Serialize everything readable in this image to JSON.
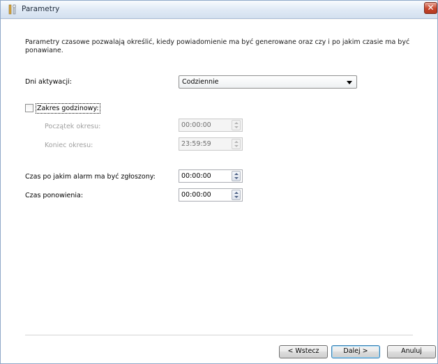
{
  "window": {
    "title": "Parametry",
    "close_glyph": "✕"
  },
  "intro": "Parametry czasowe pozwalają określić, kiedy powiadomienie ma być generowane oraz czy i po jakim czasie ma być ponawiane.",
  "activation": {
    "label": "Dni aktywacji:",
    "selected": "Codziennie"
  },
  "time_range": {
    "checkbox_label": "Zakres godzinowy:",
    "checked": false,
    "start_label": "Początek okresu:",
    "start_value": "00:00:00",
    "end_label": "Koniec okresu:",
    "end_value": "23:59:59"
  },
  "alarm": {
    "label": "Czas po jakim alarm ma być zgłoszony:",
    "value": "00:00:00"
  },
  "repeat": {
    "label": "Czas ponowienia:",
    "value": "00:00:00"
  },
  "buttons": {
    "back": "< Wstecz",
    "next": "Dalej >",
    "cancel": "Anuluj"
  },
  "colors": {
    "title_gradient_end": "#d3e0ef",
    "close": "#c7442b",
    "default_button_border": "#3c7fb1",
    "disabled_text": "#a0a0a0"
  },
  "icons": {
    "title": "wizard-wrench-icon",
    "combo": "chevron-down-icon",
    "spinner": "spin-arrows-icon"
  }
}
